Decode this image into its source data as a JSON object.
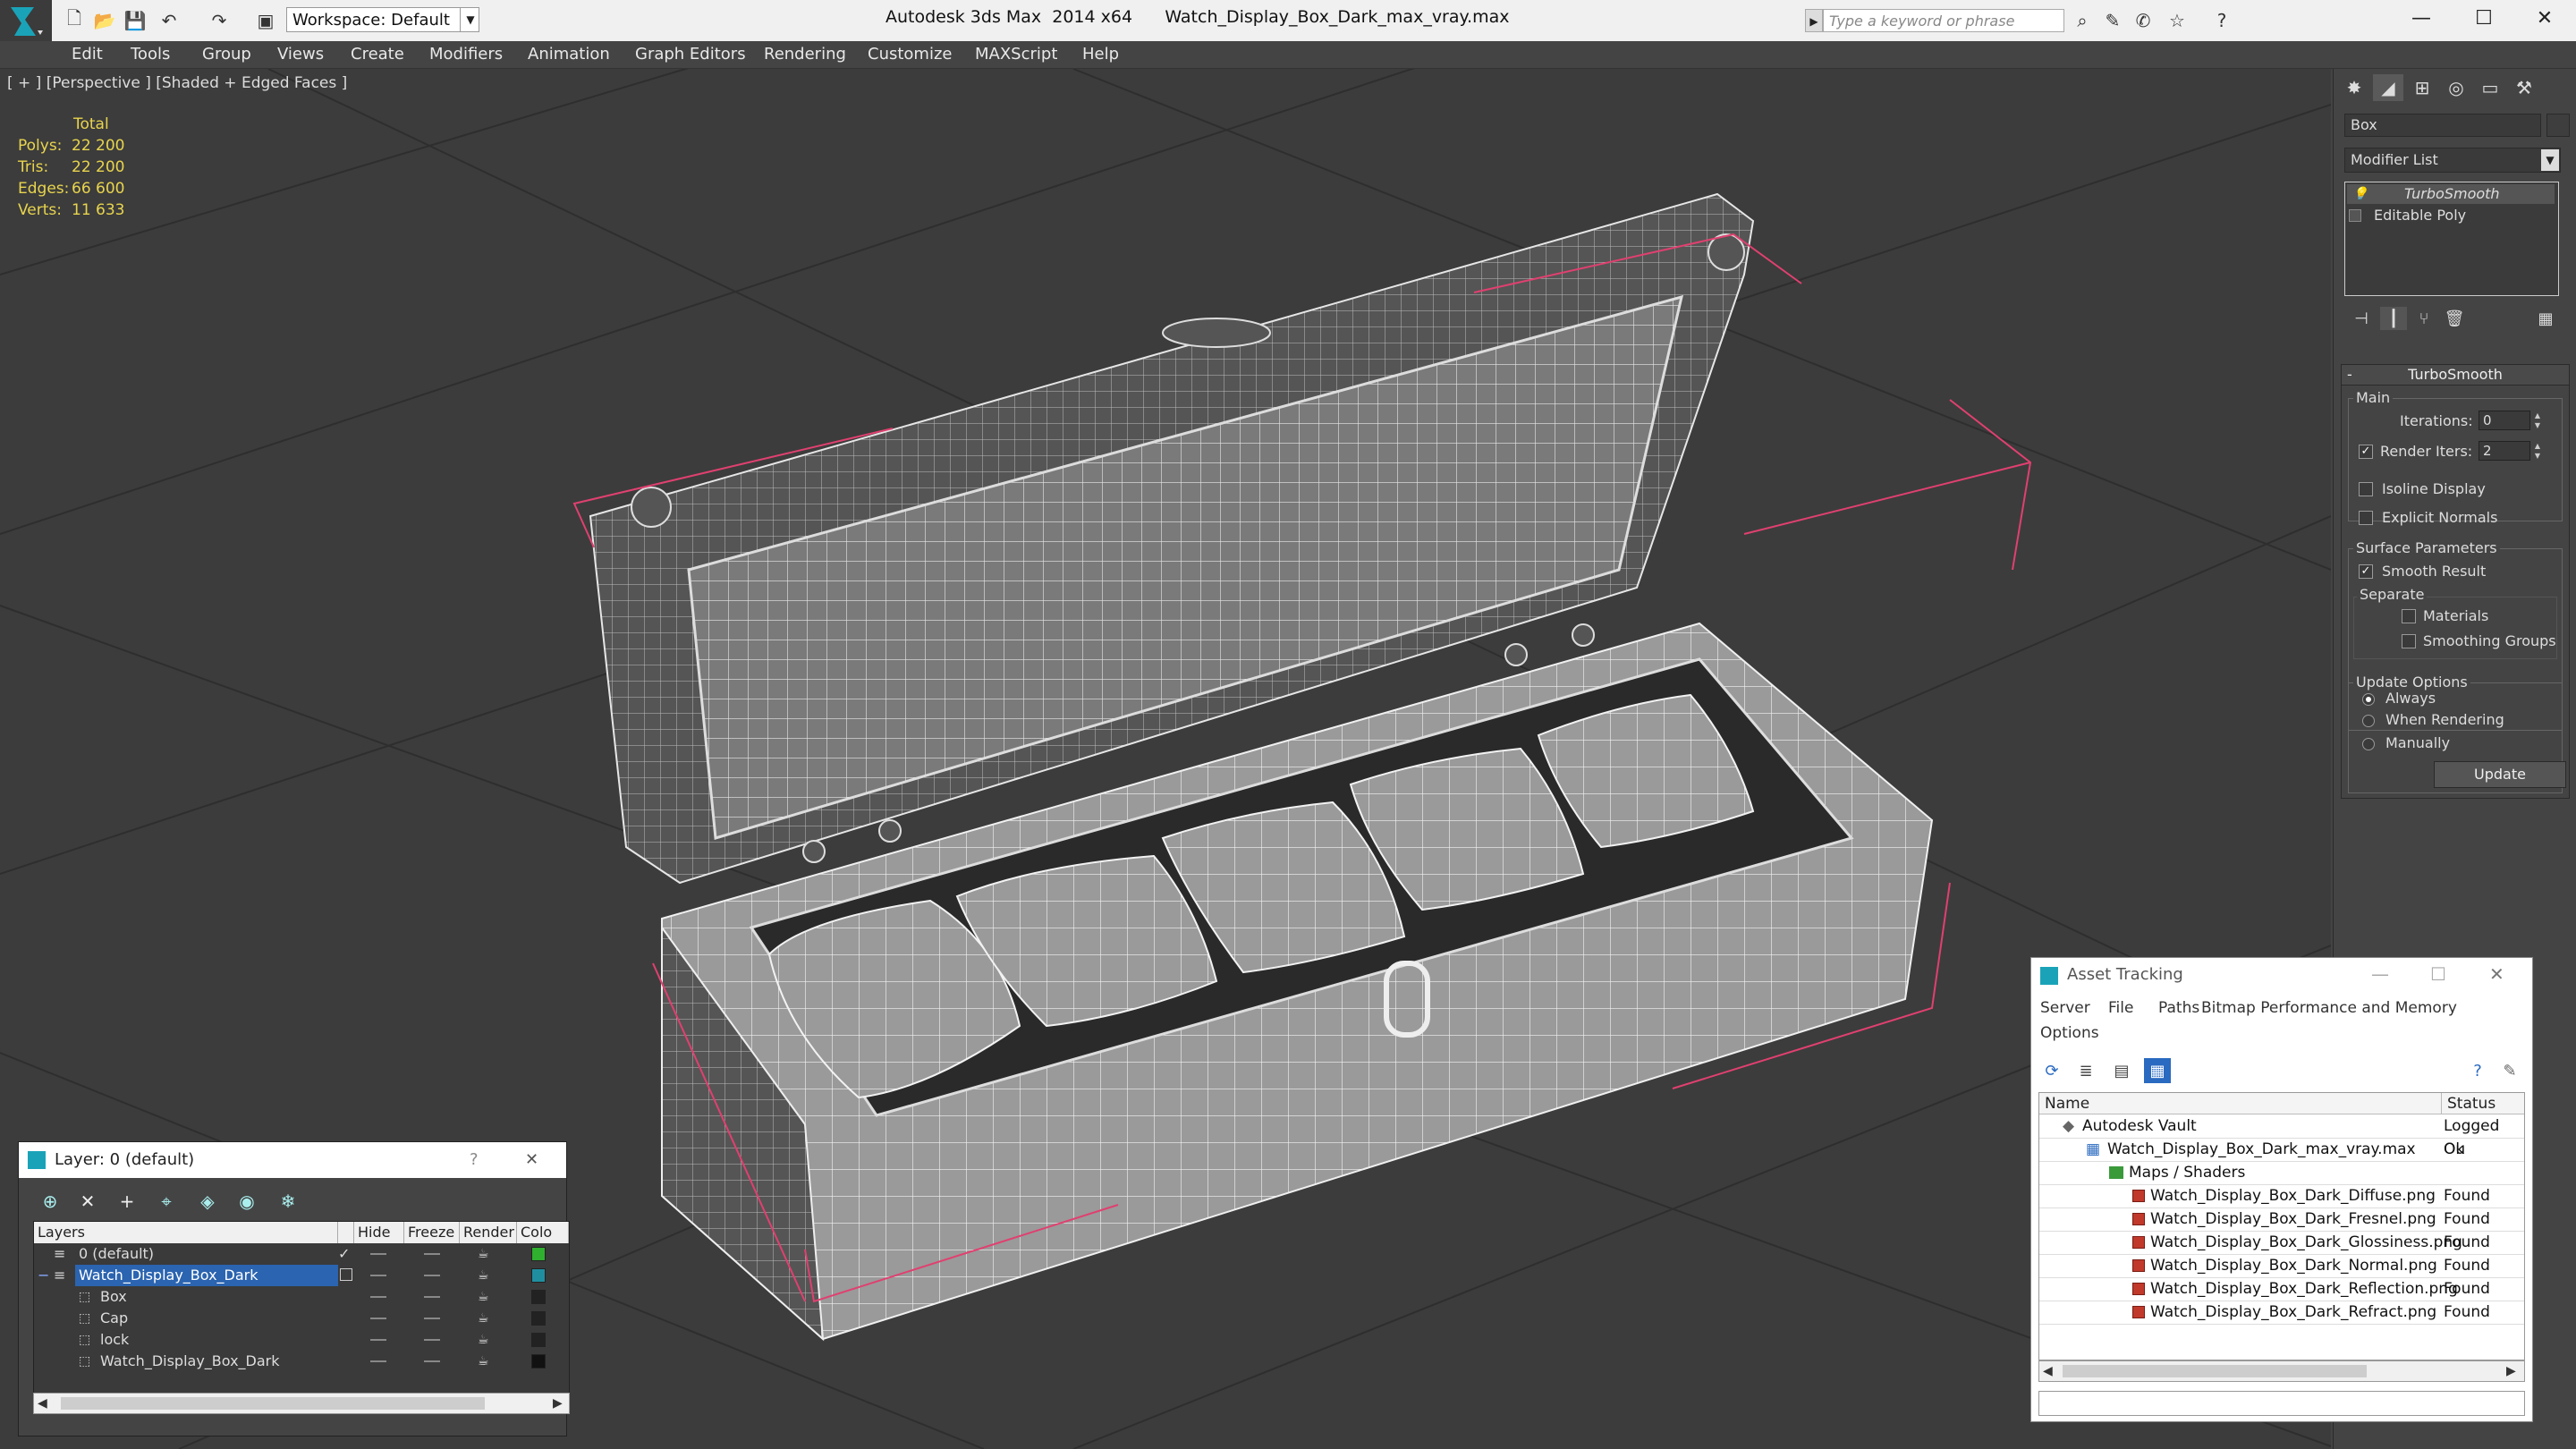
{
  "titlebar": {
    "workspace": "Workspace: Default",
    "app_name": "Autodesk 3ds Max  2014 x64",
    "file_name": "Watch_Display_Box_Dark_max_vray.max",
    "search_placeholder": "Type a keyword or phrase"
  },
  "menu": [
    "Edit",
    "Tools",
    "Group",
    "Views",
    "Create",
    "Modifiers",
    "Animation",
    "Graph Editors",
    "Rendering",
    "Customize",
    "MAXScript",
    "Help"
  ],
  "viewport": {
    "label": "[ + ] [Perspective ] [Shaded + Edged Faces ]",
    "stats": {
      "header": "Total",
      "rows": [
        {
          "label": "Polys:",
          "value": "22 200"
        },
        {
          "label": "Tris:",
          "value": "22 200"
        },
        {
          "label": "Edges:",
          "value": "66 600"
        },
        {
          "label": "Verts:",
          "value": "11 633"
        }
      ]
    }
  },
  "command_panel": {
    "object_name": "Box",
    "modifier_list": "Modifier List",
    "stack": [
      "TurboSmooth",
      "Editable Poly"
    ],
    "turbosmooth": {
      "title": "TurboSmooth",
      "main": "Main",
      "iterations_label": "Iterations:",
      "iterations": "0",
      "render_iters_label": "Render Iters:",
      "render_iters": "2",
      "isoline": "Isoline Display",
      "explicit_normals": "Explicit Normals",
      "surface_params": "Surface Parameters",
      "smooth_result": "Smooth Result",
      "separate": "Separate",
      "materials": "Materials",
      "smoothing_groups": "Smoothing Groups",
      "update_options": "Update Options",
      "always": "Always",
      "when_rendering": "When Rendering",
      "manually": "Manually",
      "update": "Update"
    }
  },
  "layer_dialog": {
    "title": "Layer: 0 (default)",
    "help": "?",
    "columns": [
      "Layers",
      "Hide",
      "Freeze",
      "Render",
      "Colo"
    ],
    "rows": [
      {
        "name": "0 (default)",
        "indent": 0,
        "color": "#2fb02f",
        "checked": true
      },
      {
        "name": "Watch_Display_Box_Dark",
        "indent": 0,
        "color": "#1f8fa0",
        "selected": true
      },
      {
        "name": "Box",
        "indent": 1,
        "color": "#222222"
      },
      {
        "name": "Cap",
        "indent": 1,
        "color": "#222222"
      },
      {
        "name": "lock",
        "indent": 1,
        "color": "#222222"
      },
      {
        "name": "Watch_Display_Box_Dark",
        "indent": 1,
        "color": "#111111"
      }
    ]
  },
  "asset_tracking": {
    "title": "Asset Tracking",
    "menu": [
      "Server",
      "File",
      "Paths",
      "Bitmap Performance and Memory",
      "Options"
    ],
    "columns": [
      "Name",
      "Status"
    ],
    "rows": [
      {
        "name": "Autodesk Vault",
        "status": "Logged Ou",
        "indent": 0,
        "icon": "vault"
      },
      {
        "name": "Watch_Display_Box_Dark_max_vray.max",
        "status": "Ok",
        "indent": 1,
        "icon": "max"
      },
      {
        "name": "Maps / Shaders",
        "status": "",
        "indent": 2,
        "icon": "folder"
      },
      {
        "name": "Watch_Display_Box_Dark_Diffuse.png",
        "status": "Found",
        "indent": 3,
        "icon": "png"
      },
      {
        "name": "Watch_Display_Box_Dark_Fresnel.png",
        "status": "Found",
        "indent": 3,
        "icon": "png"
      },
      {
        "name": "Watch_Display_Box_Dark_Glossiness.png",
        "status": "Found",
        "indent": 3,
        "icon": "png"
      },
      {
        "name": "Watch_Display_Box_Dark_Normal.png",
        "status": "Found",
        "indent": 3,
        "icon": "png"
      },
      {
        "name": "Watch_Display_Box_Dark_Reflection.png",
        "status": "Found",
        "indent": 3,
        "icon": "png"
      },
      {
        "name": "Watch_Display_Box_Dark_Refract.png",
        "status": "Found",
        "indent": 3,
        "icon": "png"
      }
    ]
  },
  "colors": {
    "accent_selection": "#2b64b0",
    "stats_yellow": "#e8d44d",
    "bbox_pink": "#e04070"
  }
}
